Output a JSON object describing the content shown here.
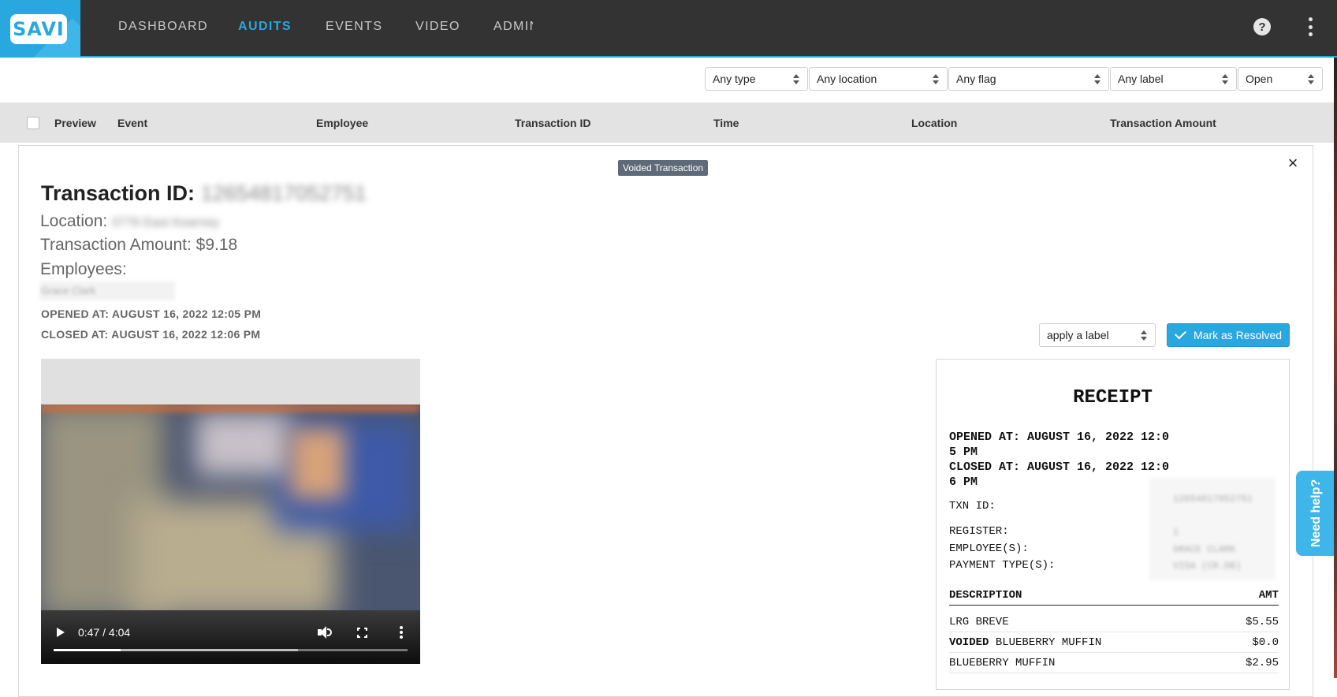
{
  "logo": {
    "text": "SAVI"
  },
  "nav": {
    "items": [
      {
        "label": "DASHBOARD",
        "active": false
      },
      {
        "label": "AUDITS",
        "active": true
      },
      {
        "label": "EVENTS",
        "active": false
      },
      {
        "label": "VIDEO",
        "active": false
      },
      {
        "label": "ADMIN",
        "active": false
      }
    ],
    "help_label": "?"
  },
  "filters": {
    "type": "Any type",
    "location": "Any location",
    "flag": "Any flag",
    "label": "Any label",
    "status": "Open"
  },
  "table": {
    "columns": [
      "Preview",
      "Event",
      "Employee",
      "Transaction ID",
      "Time",
      "Location",
      "Transaction Amount"
    ]
  },
  "detail": {
    "badge": "Voided Transaction",
    "close_label": "×",
    "title_prefix": "Transaction ID:",
    "transaction_id": "12654817052751",
    "location_label": "Location:",
    "location_value": "0776 East Kearney",
    "amount_label": "Transaction Amount: $9.18",
    "employees_label": "Employees:",
    "employee_name": "Grace Clark",
    "opened_at": "OPENED AT: AUGUST 16, 2022 12:05 PM",
    "closed_at": "CLOSED AT: AUGUST 16, 2022 12:06 PM",
    "label_select": "apply a label",
    "resolve_button": "Mark as Resolved"
  },
  "video": {
    "time": "0:47 / 4:04",
    "played_fraction": 0.19,
    "buffered_fraction": 0.69
  },
  "receipt": {
    "title": "RECEIPT",
    "opened_line1": "OPENED AT: AUGUST 16, 2022 12:0",
    "opened_line2": "5 PM",
    "closed_line1": "CLOSED AT: AUGUST 16, 2022 12:0",
    "closed_line2": "6 PM",
    "txn_label": "TXN ID:",
    "txn_value": "12654817052751",
    "register_label": "REGISTER:",
    "register_value": "1",
    "employees_label": "EMPLOYEE(S):",
    "employees_value": "GRACE CLARK",
    "payment_label": "PAYMENT TYPE(S):",
    "payment_value": "VISA (CR.DB)",
    "desc_header": "DESCRIPTION",
    "amt_header": "AMT",
    "items": [
      {
        "prefix": "",
        "name": "LRG BREVE",
        "amount": "$5.55"
      },
      {
        "prefix": "VOIDED",
        "name": "BLUEBERRY MUFFIN",
        "amount": "$0.0"
      },
      {
        "prefix": "",
        "name": "BLUEBERRY MUFFIN",
        "amount": "$2.95"
      }
    ]
  },
  "help_tab": {
    "label": "Need help?"
  },
  "colors": {
    "accent": "#29a8e0",
    "nav_bg": "#333333",
    "badge_bg": "#5d6b78"
  }
}
